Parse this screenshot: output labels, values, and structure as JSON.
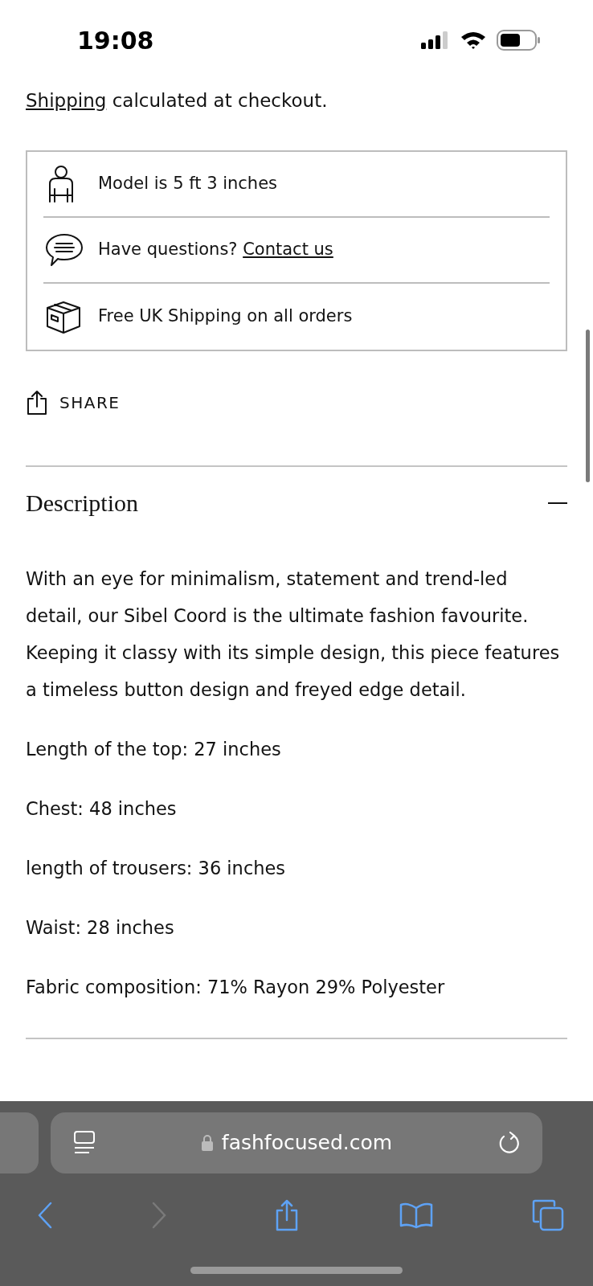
{
  "status_bar": {
    "time": "19:08"
  },
  "shipping_note": {
    "link": "Shipping",
    "text": "calculated at checkout."
  },
  "info_box": [
    {
      "kind": "model",
      "text": "Model is 5 ft 3 inches"
    },
    {
      "kind": "questions",
      "text": "Have questions?",
      "link": "Contact us"
    },
    {
      "kind": "shipping",
      "text": "Free UK Shipping on all orders"
    }
  ],
  "share": {
    "label": "SHARE"
  },
  "description": {
    "title": "Description",
    "expanded": true,
    "paragraphs": [
      "With an eye for minimalism, statement and trend-led detail, our Sibel Coord is the ultimate fashion favourite. Keeping it classy with its simple design, this piece features a timeless button design and freyed edge detail.",
      "Length of the top: 27 inches",
      "Chest: 48 inches",
      "length of trousers: 36 inches",
      "Waist: 28 inches",
      "Fabric composition: 71% Rayon 29% Polyester"
    ]
  },
  "browser": {
    "url": "fashfocused.com"
  }
}
